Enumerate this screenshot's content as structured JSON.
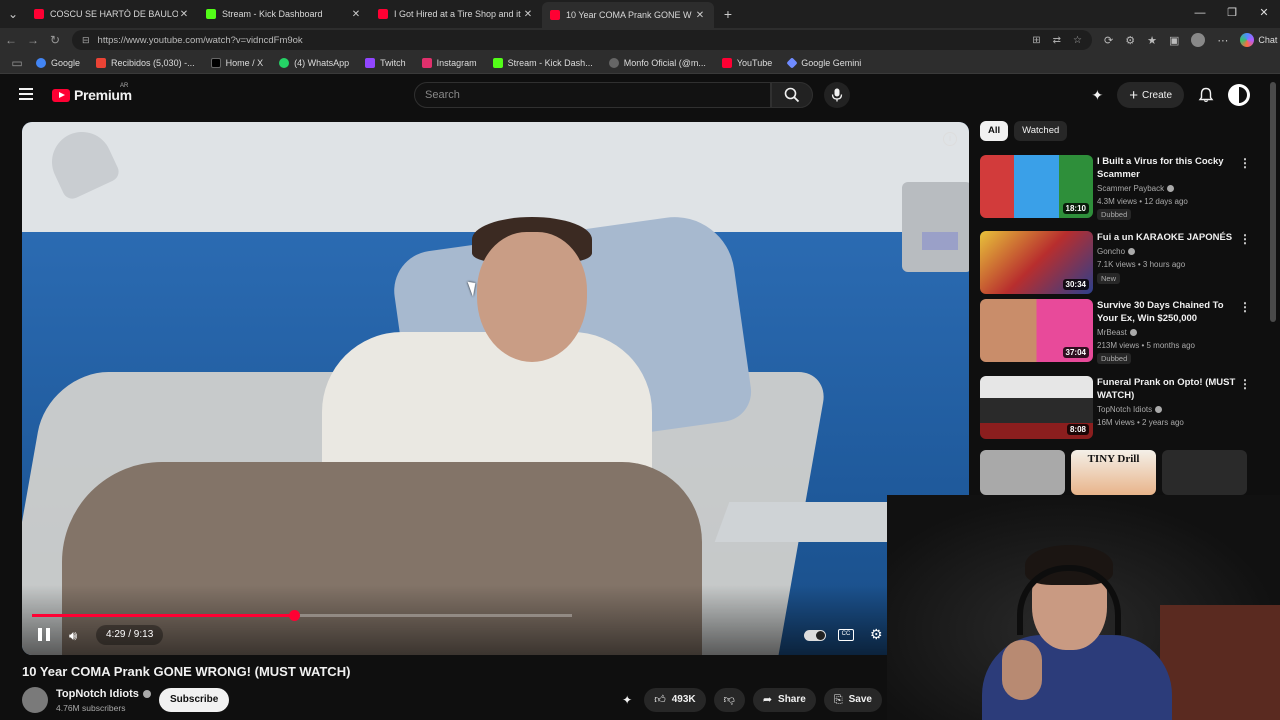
{
  "browser": {
    "tabs": [
      {
        "title": "COSCU SE HARTÓ DE BAULO Y LE",
        "favicon": "youtube",
        "active": false
      },
      {
        "title": "Stream - Kick Dashboard",
        "favicon": "kick",
        "active": false
      },
      {
        "title": "I Got Hired at a Tire Shop and it W",
        "favicon": "youtube",
        "active": false
      },
      {
        "title": "10 Year COMA Prank GONE W",
        "favicon": "youtube",
        "active": true
      }
    ],
    "url": "https://www.youtube.com/watch?v=vidncdFm9ok",
    "chat_label": "Chat",
    "bookmarks": [
      "Google",
      "Recibidos (5,030) -...",
      "Home / X",
      "(4) WhatsApp",
      "Twitch",
      "Instagram",
      "Stream - Kick Dash...",
      "Monfo Oficial (@m...",
      "YouTube",
      "Google Gemini"
    ]
  },
  "youtube": {
    "logo_text": "Premium",
    "country_code": "AR",
    "search_placeholder": "Search",
    "create_label": "Create"
  },
  "player": {
    "current_time": "4:29",
    "duration": "9:13",
    "time_display": "4:29 / 9:13",
    "progress_fraction": 0.486
  },
  "video": {
    "title": "10 Year COMA Prank GONE WRONG! (MUST WATCH)",
    "channel": "TopNotch Idiots",
    "subscribers": "4.76M subscribers",
    "subscribe_label": "Subscribe",
    "likes": "493K",
    "share_label": "Share",
    "save_label": "Save"
  },
  "sidebar": {
    "chips": [
      "All",
      "Watched"
    ],
    "recommendations": [
      {
        "title": "I Built a Virus for this Cocky Scammer",
        "channel": "Scammer Payback",
        "meta": "4.3M views • 12 days ago",
        "badge": "Dubbed",
        "duration": "18:10"
      },
      {
        "title": "Fui a un KARAOKE JAPONÉS",
        "channel": "Goncho",
        "meta": "7.1K views • 3 hours ago",
        "badge": "New",
        "duration": "30:34"
      },
      {
        "title": "Survive 30 Days Chained To Your Ex, Win $250,000",
        "channel": "MrBeast",
        "meta": "213M views • 5 months ago",
        "badge": "Dubbed",
        "duration": "37:04"
      },
      {
        "title": "Funeral Prank on Opto! (MUST WATCH)",
        "channel": "TopNotch Idiots",
        "meta": "16M views • 2 years ago",
        "badge": "",
        "duration": "8:08"
      }
    ],
    "shorts_label": "TINY Drill"
  },
  "colors": {
    "accent": "#ff0033",
    "background": "#0f0f0f"
  }
}
